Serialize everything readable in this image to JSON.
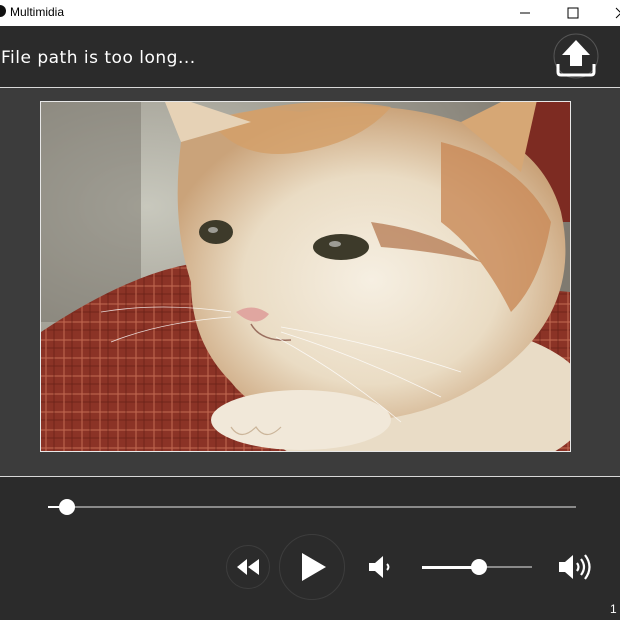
{
  "window": {
    "title": "Multimidia"
  },
  "header": {
    "file_path": "File path is too long..."
  },
  "icons": {
    "app": "app-icon",
    "minimize": "minimize-icon",
    "maximize": "maximize-icon",
    "close": "close-icon",
    "upload": "upload-icon",
    "rewind": "rewind-icon",
    "play": "play-icon",
    "volume_low": "volume-low-icon",
    "volume_high": "volume-high-icon"
  },
  "player": {
    "progress": 0.025,
    "volume": 0.52
  },
  "status": {
    "corner_text": "1"
  },
  "colors": {
    "background": "#2b2b2b",
    "video_bg": "#3c3c3c",
    "accent": "#ffffff"
  }
}
